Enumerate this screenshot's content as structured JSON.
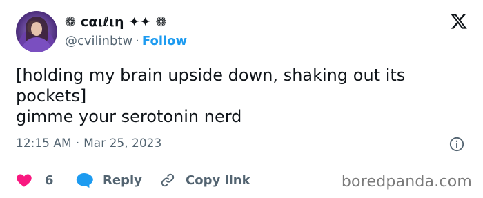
{
  "author": {
    "display_name": "❁ cαιℓιη ✦✦ ❁",
    "handle": "@cvilinbtw",
    "separator": "·",
    "follow_label": "Follow"
  },
  "tweet": {
    "lines": [
      "[holding my brain upside down, shaking out its",
      "pockets]",
      "gimme your serotonin nerd"
    ],
    "time": "12:15 AM",
    "separator": "·",
    "date": "Mar 25, 2023"
  },
  "actions": {
    "like_count": "6",
    "reply_label": "Reply",
    "copy_link_label": "Copy link"
  },
  "watermark": "boredpanda.com",
  "colors": {
    "accent": "#1d9bf0",
    "like": "#f91880",
    "text": "#0f1419",
    "muted": "#536471"
  },
  "icons": [
    "x-logo-icon",
    "info-icon",
    "heart-icon",
    "reply-bubble-icon",
    "link-icon"
  ]
}
